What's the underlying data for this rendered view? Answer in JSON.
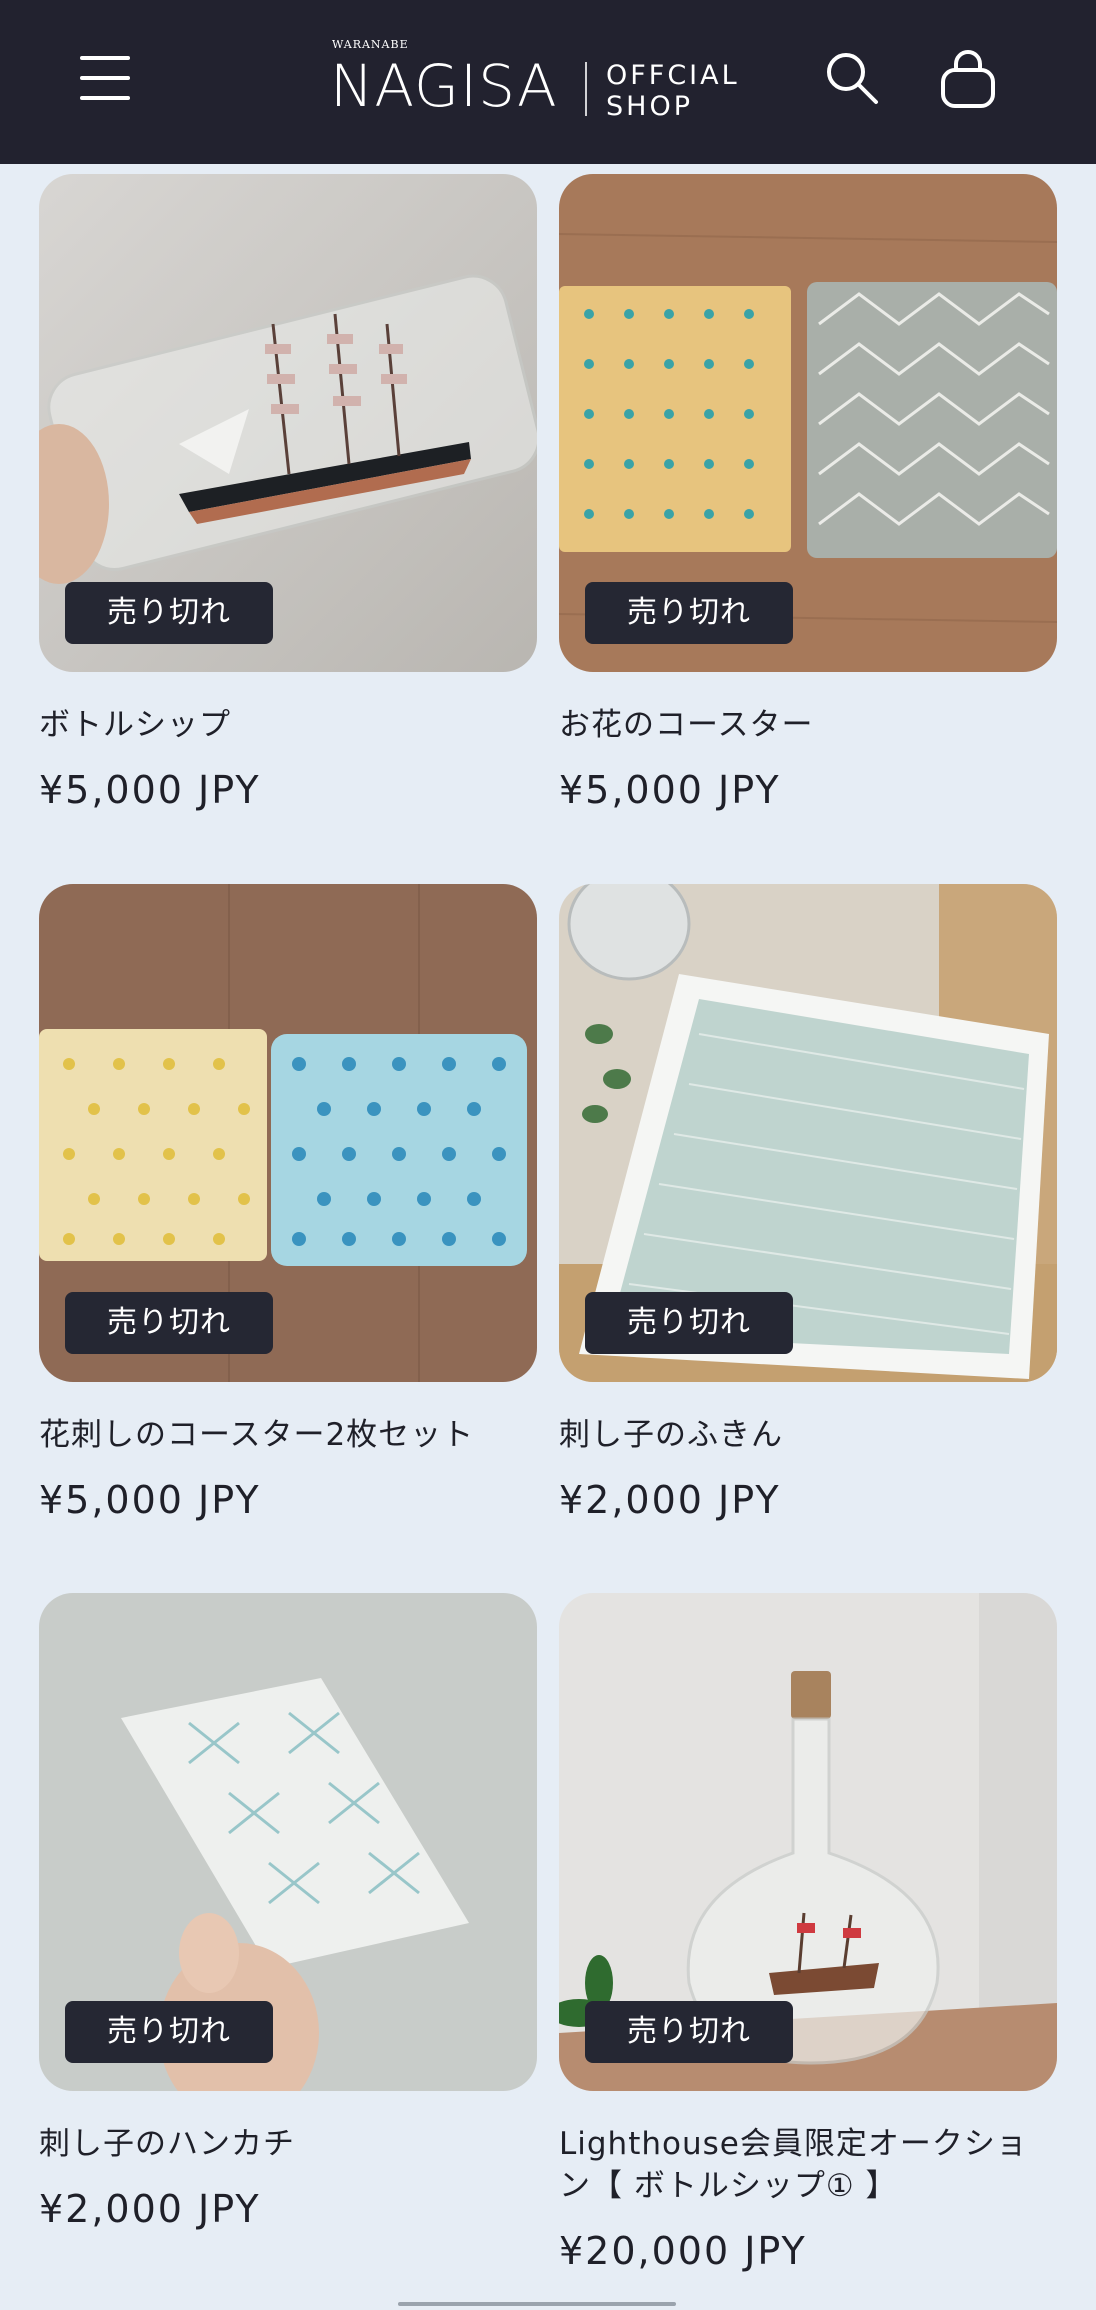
{
  "header": {
    "logo_small": "WARANABE",
    "logo_big": "NAGISA",
    "logo_sub_line1": "OFFCIAL",
    "logo_sub_line2": "SHOP",
    "icons": [
      "menu-icon",
      "search-icon",
      "cart-icon"
    ]
  },
  "products": [
    {
      "title": "ボトルシップ",
      "price": "¥5,000 JPY",
      "badge": "売り切れ"
    },
    {
      "title": "お花のコースター",
      "price": "¥5,000 JPY",
      "badge": "売り切れ"
    },
    {
      "title": "花刺しのコースター2枚セット",
      "price": "¥5,000 JPY",
      "badge": "売り切れ"
    },
    {
      "title": "刺し子のふきん",
      "price": "¥2,000 JPY",
      "badge": "売り切れ"
    },
    {
      "title": "刺し子のハンカチ",
      "price": "¥2,000 JPY",
      "badge": "売り切れ"
    },
    {
      "title": "Lighthouse会員限定オークション【 ボトルシップ① 】",
      "price": "¥20,000 JPY",
      "badge": "売り切れ"
    }
  ]
}
